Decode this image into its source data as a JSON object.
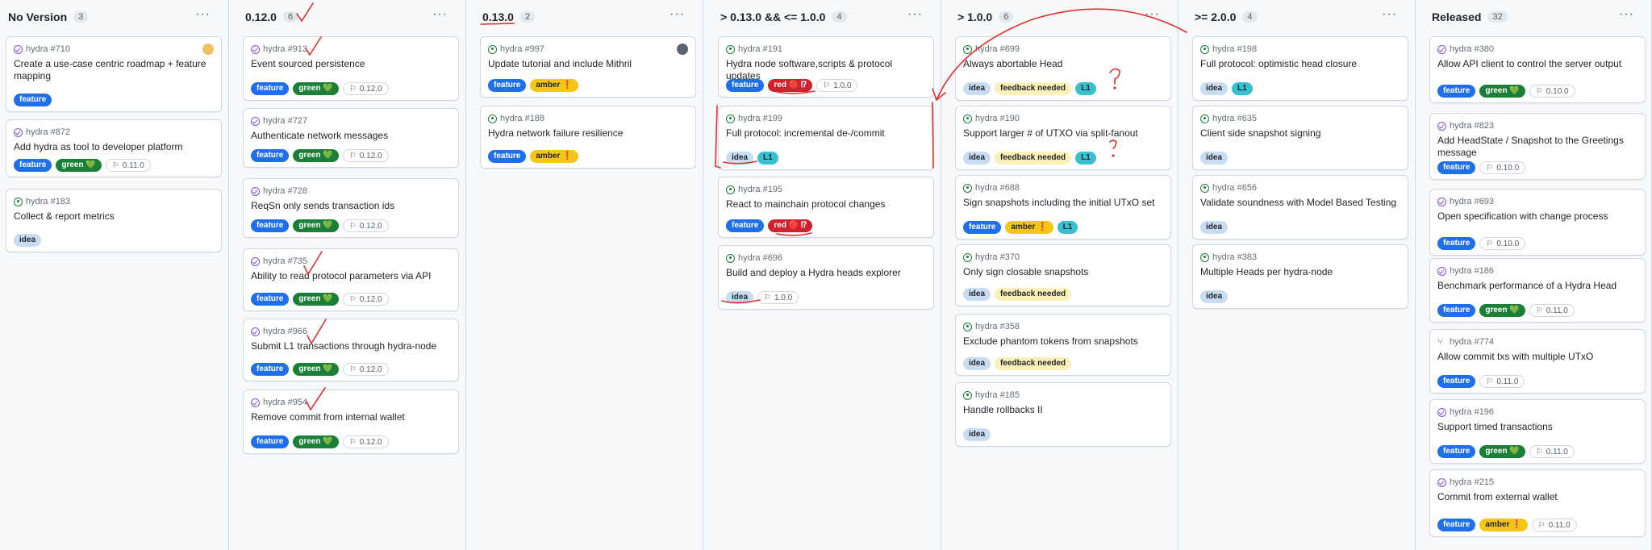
{
  "columns": [
    {
      "title": "No Version",
      "count": "3",
      "cards": [
        {
          "ref": "hydra #710",
          "state": "done",
          "title": "Create a use-case centric roadmap + feature mapping",
          "labels": [
            {
              "text": "feature",
              "kind": "feature"
            }
          ],
          "avatar": "emoji"
        },
        {
          "ref": "hydra #872",
          "state": "done",
          "title": "Add hydra as tool to developer platform",
          "labels": [
            {
              "text": "feature",
              "kind": "feature"
            },
            {
              "text": "green 💚",
              "kind": "green"
            }
          ],
          "milestone": "0.11.0"
        },
        {
          "ref": "hydra #183",
          "state": "open",
          "title": "Collect & report metrics",
          "labels": [
            {
              "text": "idea",
              "kind": "idea"
            }
          ]
        }
      ]
    },
    {
      "title": "0.12.0",
      "count": "6",
      "cards": [
        {
          "ref": "hydra #913",
          "state": "done",
          "title": "Event sourced persistence",
          "labels": [
            {
              "text": "feature",
              "kind": "feature"
            },
            {
              "text": "green 💚",
              "kind": "green"
            }
          ],
          "milestone": "0.12.0"
        },
        {
          "ref": "hydra #727",
          "state": "done",
          "title": "Authenticate network messages",
          "labels": [
            {
              "text": "feature",
              "kind": "feature"
            },
            {
              "text": "green 💚",
              "kind": "green"
            }
          ],
          "milestone": "0.12.0"
        },
        {
          "ref": "hydra #728",
          "state": "done",
          "title": "ReqSn only sends transaction ids",
          "labels": [
            {
              "text": "feature",
              "kind": "feature"
            },
            {
              "text": "green 💚",
              "kind": "green"
            }
          ],
          "milestone": "0.12.0"
        },
        {
          "ref": "hydra #735",
          "state": "done",
          "title": "Ability to read protocol parameters via API",
          "labels": [
            {
              "text": "feature",
              "kind": "feature"
            },
            {
              "text": "green 💚",
              "kind": "green"
            }
          ],
          "milestone": "0.12.0"
        },
        {
          "ref": "hydra #966",
          "state": "done",
          "title": "Submit L1 transactions through hydra-node",
          "labels": [
            {
              "text": "feature",
              "kind": "feature"
            },
            {
              "text": "green 💚",
              "kind": "green"
            }
          ],
          "milestone": "0.12.0"
        },
        {
          "ref": "hydra #954",
          "state": "done",
          "title": "Remove commit from internal wallet",
          "labels": [
            {
              "text": "feature",
              "kind": "feature"
            },
            {
              "text": "green 💚",
              "kind": "green"
            }
          ],
          "milestone": "0.12.0"
        }
      ]
    },
    {
      "title": "0.13.0",
      "count": "2",
      "cards": [
        {
          "ref": "hydra #997",
          "state": "open",
          "title": "Update tutorial and include Mithril",
          "labels": [
            {
              "text": "feature",
              "kind": "feature"
            },
            {
              "text": "amber ❗",
              "kind": "amber"
            }
          ],
          "avatar": "photo"
        },
        {
          "ref": "hydra #188",
          "state": "open",
          "title": "Hydra network failure resilience",
          "labels": [
            {
              "text": "feature",
              "kind": "feature"
            },
            {
              "text": "amber ❗",
              "kind": "amber"
            }
          ]
        }
      ]
    },
    {
      "title": "> 0.13.0 && <= 1.0.0",
      "count": "4",
      "cards": [
        {
          "ref": "hydra #191",
          "state": "open",
          "title": "Hydra node software,scripts & protocol updates",
          "labels": [
            {
              "text": "feature",
              "kind": "feature"
            },
            {
              "text": "red 🔴 ⁉",
              "kind": "red"
            }
          ],
          "milestone": "1.0.0"
        },
        {
          "ref": "hydra #199",
          "state": "open",
          "title": "Full protocol: incremental de-/commit",
          "labels": [
            {
              "text": "idea",
              "kind": "idea"
            },
            {
              "text": "L1",
              "kind": "l1"
            }
          ]
        },
        {
          "ref": "hydra #195",
          "state": "open",
          "title": "React to mainchain protocol changes",
          "labels": [
            {
              "text": "feature",
              "kind": "feature"
            },
            {
              "text": "red 🔴 ⁉",
              "kind": "red"
            }
          ]
        },
        {
          "ref": "hydra #696",
          "state": "open",
          "title": "Build and deploy a Hydra heads explorer",
          "labels": [
            {
              "text": "idea",
              "kind": "idea"
            }
          ],
          "milestone": "1.0.0"
        }
      ]
    },
    {
      "title": "> 1.0.0",
      "count": "6",
      "cards": [
        {
          "ref": "hydra #699",
          "state": "open",
          "title": "Always abortable Head",
          "labels": [
            {
              "text": "idea",
              "kind": "idea"
            },
            {
              "text": "feedback needed",
              "kind": "feedback"
            },
            {
              "text": "L1",
              "kind": "l1"
            }
          ]
        },
        {
          "ref": "hydra #190",
          "state": "open",
          "title": "Support larger # of UTXO via split-fanout",
          "labels": [
            {
              "text": "idea",
              "kind": "idea"
            },
            {
              "text": "feedback needed",
              "kind": "feedback"
            },
            {
              "text": "L1",
              "kind": "l1"
            }
          ]
        },
        {
          "ref": "hydra #688",
          "state": "open",
          "title": "Sign snapshots including the initial UTxO set",
          "labels": [
            {
              "text": "feature",
              "kind": "feature"
            },
            {
              "text": "amber ❗",
              "kind": "amber"
            },
            {
              "text": "L1",
              "kind": "l1"
            }
          ]
        },
        {
          "ref": "hydra #370",
          "state": "open",
          "title": "Only sign closable snapshots",
          "labels": [
            {
              "text": "idea",
              "kind": "idea"
            },
            {
              "text": "feedback needed",
              "kind": "feedback"
            }
          ]
        },
        {
          "ref": "hydra #358",
          "state": "open",
          "title": "Exclude phantom tokens from snapshots",
          "labels": [
            {
              "text": "idea",
              "kind": "idea"
            },
            {
              "text": "feedback needed",
              "kind": "feedback"
            }
          ]
        },
        {
          "ref": "hydra #185",
          "state": "open",
          "title": "Handle rollbacks II",
          "labels": [
            {
              "text": "idea",
              "kind": "idea"
            }
          ]
        }
      ]
    },
    {
      "title": ">= 2.0.0",
      "count": "4",
      "cards": [
        {
          "ref": "hydra #198",
          "state": "open",
          "title": "Full protocol: optimistic head closure",
          "labels": [
            {
              "text": "idea",
              "kind": "idea"
            },
            {
              "text": "L1",
              "kind": "l1"
            }
          ]
        },
        {
          "ref": "hydra #635",
          "state": "open",
          "title": "Client side snapshot signing",
          "labels": [
            {
              "text": "idea",
              "kind": "idea"
            }
          ]
        },
        {
          "ref": "hydra #656",
          "state": "open",
          "title": "Validate soundness with Model Based Testing",
          "labels": [
            {
              "text": "idea",
              "kind": "idea"
            }
          ]
        },
        {
          "ref": "hydra #383",
          "state": "open",
          "title": "Multiple Heads per hydra-node",
          "labels": [
            {
              "text": "idea",
              "kind": "idea"
            }
          ]
        }
      ]
    },
    {
      "title": "Released",
      "count": "32",
      "cards": [
        {
          "ref": "hydra #380",
          "state": "done",
          "title": "Allow API client to control the server output",
          "labels": [
            {
              "text": "feature",
              "kind": "feature"
            },
            {
              "text": "green 💚",
              "kind": "green"
            }
          ],
          "milestone": "0.10.0"
        },
        {
          "ref": "hydra #823",
          "state": "done",
          "title": "Add HeadState / Snapshot to the Greetings message",
          "labels": [
            {
              "text": "feature",
              "kind": "feature"
            }
          ],
          "milestone": "0.10.0"
        },
        {
          "ref": "hydra #693",
          "state": "done",
          "title": "Open specification with change process",
          "labels": [
            {
              "text": "feature",
              "kind": "feature"
            }
          ],
          "milestone": "0.10.0"
        },
        {
          "ref": "hydra #186",
          "state": "done",
          "title": "Benchmark performance of a Hydra Head",
          "labels": [
            {
              "text": "feature",
              "kind": "feature"
            },
            {
              "text": "green 💚",
              "kind": "green"
            }
          ],
          "milestone": "0.11.0"
        },
        {
          "ref": "hydra #774",
          "state": "pr",
          "title": "Allow commit txs with multiple UTxO",
          "labels": [
            {
              "text": "feature",
              "kind": "feature"
            }
          ],
          "milestone": "0.11.0"
        },
        {
          "ref": "hydra #196",
          "state": "done",
          "title": "Support timed transactions",
          "labels": [
            {
              "text": "feature",
              "kind": "feature"
            },
            {
              "text": "green 💚",
              "kind": "green"
            }
          ],
          "milestone": "0.11.0"
        },
        {
          "ref": "hydra #215",
          "state": "done",
          "title": "Commit from external wallet",
          "labels": [
            {
              "text": "feature",
              "kind": "feature"
            },
            {
              "text": "amber ❗",
              "kind": "amber"
            }
          ],
          "milestone": "0.11.0"
        }
      ]
    }
  ]
}
